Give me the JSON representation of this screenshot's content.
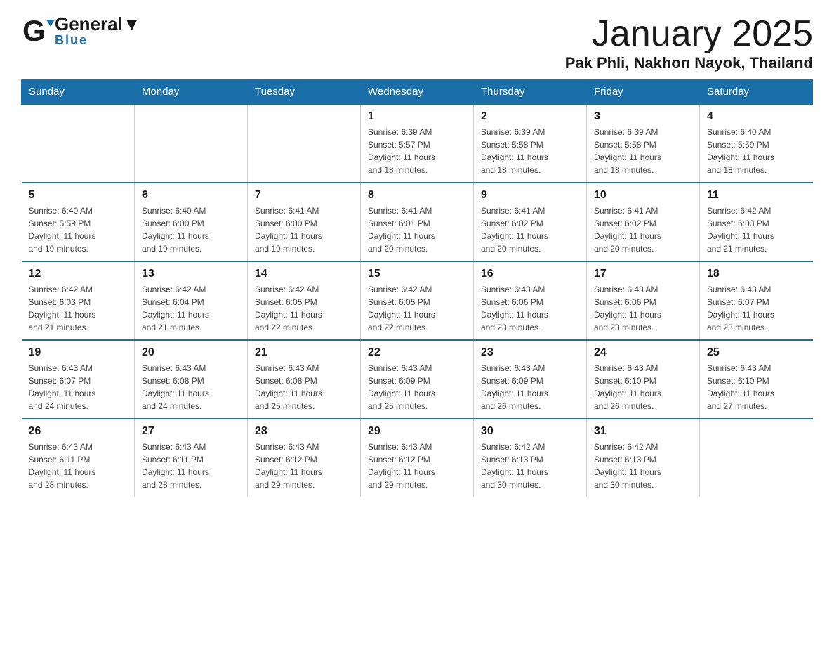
{
  "header": {
    "logo": {
      "general": "General",
      "blue": "Blue"
    },
    "title": "January 2025",
    "subtitle": "Pak Phli, Nakhon Nayok, Thailand"
  },
  "calendar": {
    "days": [
      "Sunday",
      "Monday",
      "Tuesday",
      "Wednesday",
      "Thursday",
      "Friday",
      "Saturday"
    ],
    "weeks": [
      {
        "cells": [
          {
            "day": null
          },
          {
            "day": null
          },
          {
            "day": null
          },
          {
            "day": "1",
            "sunrise": "6:39 AM",
            "sunset": "5:57 PM",
            "daylight": "11 hours and 18 minutes."
          },
          {
            "day": "2",
            "sunrise": "6:39 AM",
            "sunset": "5:58 PM",
            "daylight": "11 hours and 18 minutes."
          },
          {
            "day": "3",
            "sunrise": "6:39 AM",
            "sunset": "5:58 PM",
            "daylight": "11 hours and 18 minutes."
          },
          {
            "day": "4",
            "sunrise": "6:40 AM",
            "sunset": "5:59 PM",
            "daylight": "11 hours and 18 minutes."
          }
        ]
      },
      {
        "cells": [
          {
            "day": "5",
            "sunrise": "6:40 AM",
            "sunset": "5:59 PM",
            "daylight": "11 hours and 19 minutes."
          },
          {
            "day": "6",
            "sunrise": "6:40 AM",
            "sunset": "6:00 PM",
            "daylight": "11 hours and 19 minutes."
          },
          {
            "day": "7",
            "sunrise": "6:41 AM",
            "sunset": "6:00 PM",
            "daylight": "11 hours and 19 minutes."
          },
          {
            "day": "8",
            "sunrise": "6:41 AM",
            "sunset": "6:01 PM",
            "daylight": "11 hours and 20 minutes."
          },
          {
            "day": "9",
            "sunrise": "6:41 AM",
            "sunset": "6:02 PM",
            "daylight": "11 hours and 20 minutes."
          },
          {
            "day": "10",
            "sunrise": "6:41 AM",
            "sunset": "6:02 PM",
            "daylight": "11 hours and 20 minutes."
          },
          {
            "day": "11",
            "sunrise": "6:42 AM",
            "sunset": "6:03 PM",
            "daylight": "11 hours and 21 minutes."
          }
        ]
      },
      {
        "cells": [
          {
            "day": "12",
            "sunrise": "6:42 AM",
            "sunset": "6:03 PM",
            "daylight": "11 hours and 21 minutes."
          },
          {
            "day": "13",
            "sunrise": "6:42 AM",
            "sunset": "6:04 PM",
            "daylight": "11 hours and 21 minutes."
          },
          {
            "day": "14",
            "sunrise": "6:42 AM",
            "sunset": "6:05 PM",
            "daylight": "11 hours and 22 minutes."
          },
          {
            "day": "15",
            "sunrise": "6:42 AM",
            "sunset": "6:05 PM",
            "daylight": "11 hours and 22 minutes."
          },
          {
            "day": "16",
            "sunrise": "6:43 AM",
            "sunset": "6:06 PM",
            "daylight": "11 hours and 23 minutes."
          },
          {
            "day": "17",
            "sunrise": "6:43 AM",
            "sunset": "6:06 PM",
            "daylight": "11 hours and 23 minutes."
          },
          {
            "day": "18",
            "sunrise": "6:43 AM",
            "sunset": "6:07 PM",
            "daylight": "11 hours and 23 minutes."
          }
        ]
      },
      {
        "cells": [
          {
            "day": "19",
            "sunrise": "6:43 AM",
            "sunset": "6:07 PM",
            "daylight": "11 hours and 24 minutes."
          },
          {
            "day": "20",
            "sunrise": "6:43 AM",
            "sunset": "6:08 PM",
            "daylight": "11 hours and 24 minutes."
          },
          {
            "day": "21",
            "sunrise": "6:43 AM",
            "sunset": "6:08 PM",
            "daylight": "11 hours and 25 minutes."
          },
          {
            "day": "22",
            "sunrise": "6:43 AM",
            "sunset": "6:09 PM",
            "daylight": "11 hours and 25 minutes."
          },
          {
            "day": "23",
            "sunrise": "6:43 AM",
            "sunset": "6:09 PM",
            "daylight": "11 hours and 26 minutes."
          },
          {
            "day": "24",
            "sunrise": "6:43 AM",
            "sunset": "6:10 PM",
            "daylight": "11 hours and 26 minutes."
          },
          {
            "day": "25",
            "sunrise": "6:43 AM",
            "sunset": "6:10 PM",
            "daylight": "11 hours and 27 minutes."
          }
        ]
      },
      {
        "cells": [
          {
            "day": "26",
            "sunrise": "6:43 AM",
            "sunset": "6:11 PM",
            "daylight": "11 hours and 28 minutes."
          },
          {
            "day": "27",
            "sunrise": "6:43 AM",
            "sunset": "6:11 PM",
            "daylight": "11 hours and 28 minutes."
          },
          {
            "day": "28",
            "sunrise": "6:43 AM",
            "sunset": "6:12 PM",
            "daylight": "11 hours and 29 minutes."
          },
          {
            "day": "29",
            "sunrise": "6:43 AM",
            "sunset": "6:12 PM",
            "daylight": "11 hours and 29 minutes."
          },
          {
            "day": "30",
            "sunrise": "6:42 AM",
            "sunset": "6:13 PM",
            "daylight": "11 hours and 30 minutes."
          },
          {
            "day": "31",
            "sunrise": "6:42 AM",
            "sunset": "6:13 PM",
            "daylight": "11 hours and 30 minutes."
          },
          {
            "day": null
          }
        ]
      }
    ]
  }
}
